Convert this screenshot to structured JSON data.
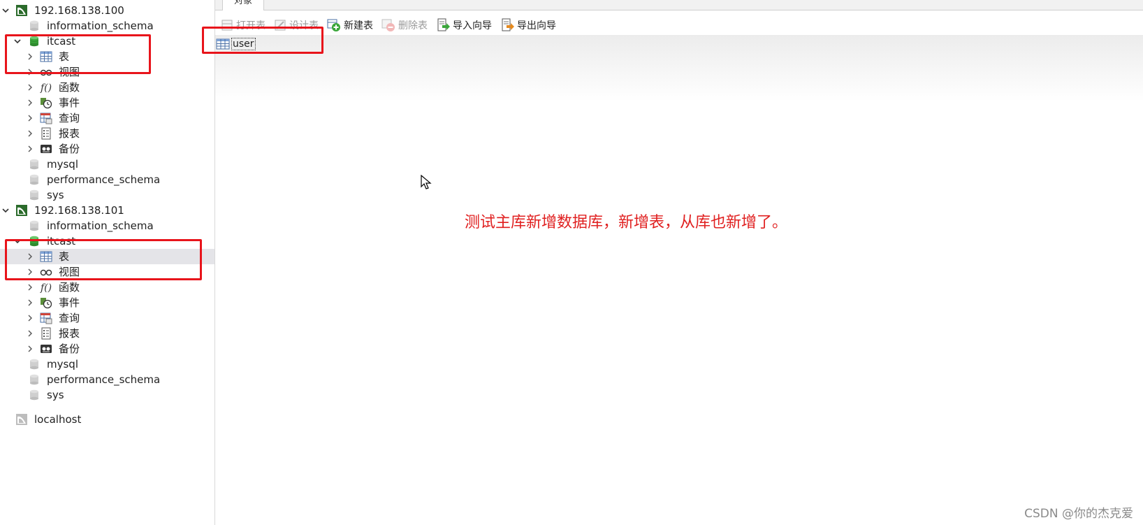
{
  "tree": {
    "server1": {
      "label": "192.168.138.100",
      "databases": {
        "information_schema": "information_schema",
        "itcast": "itcast",
        "tables": "表",
        "views": "视图",
        "functions": "函数",
        "events": "事件",
        "queries": "查询",
        "reports": "报表",
        "backups": "备份",
        "mysql": "mysql",
        "performance_schema": "performance_schema",
        "sys": "sys"
      }
    },
    "server2": {
      "label": "192.168.138.101",
      "databases": {
        "information_schema": "information_schema",
        "itcast": "itcast",
        "tables": "表",
        "views": "视图",
        "functions": "函数",
        "events": "事件",
        "queries": "查询",
        "reports": "报表",
        "backups": "备份",
        "mysql": "mysql",
        "performance_schema": "performance_schema",
        "sys": "sys"
      }
    },
    "server3": {
      "label": "localhost"
    }
  },
  "tabs": {
    "objects": "对象"
  },
  "toolbar": {
    "open_table": "打开表",
    "design_table": "设计表",
    "new_table": "新建表",
    "delete_table": "删除表",
    "import_wizard": "导入向导",
    "export_wizard": "导出向导"
  },
  "objects": {
    "user_table": "user"
  },
  "annotation": "测试主库新增数据库，新增表，从库也新增了。",
  "watermark": "CSDN @你的杰克爱",
  "colors": {
    "highlight_box": "#e8141b",
    "annotation_text": "#e02020",
    "db_icon_active": "#3aa63a"
  }
}
